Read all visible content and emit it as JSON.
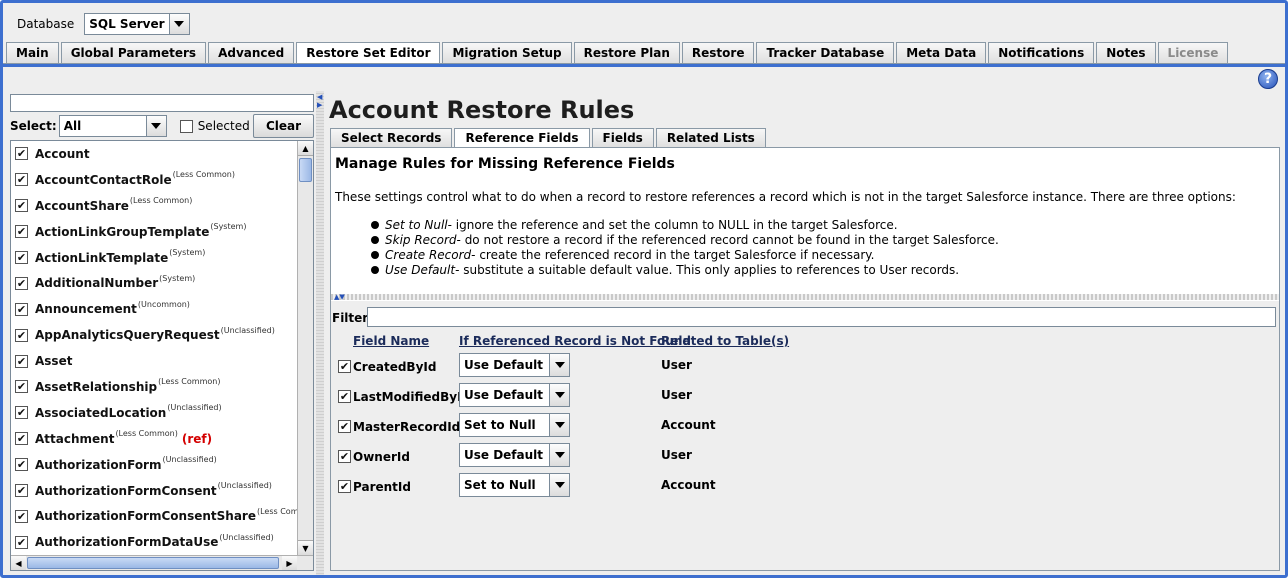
{
  "database": {
    "label": "Database",
    "value": "SQL Server"
  },
  "main_tabs": [
    {
      "label": "Main",
      "active": false,
      "disabled": false
    },
    {
      "label": "Global Parameters",
      "active": false,
      "disabled": false
    },
    {
      "label": "Advanced",
      "active": false,
      "disabled": false
    },
    {
      "label": "Restore Set Editor",
      "active": true,
      "disabled": false
    },
    {
      "label": "Migration Setup",
      "active": false,
      "disabled": false
    },
    {
      "label": "Restore Plan",
      "active": false,
      "disabled": false
    },
    {
      "label": "Restore",
      "active": false,
      "disabled": false
    },
    {
      "label": "Tracker Database",
      "active": false,
      "disabled": false
    },
    {
      "label": "Meta Data",
      "active": false,
      "disabled": false
    },
    {
      "label": "Notifications",
      "active": false,
      "disabled": false
    },
    {
      "label": "Notes",
      "active": false,
      "disabled": false
    },
    {
      "label": "License",
      "active": false,
      "disabled": true
    }
  ],
  "help_icon": "help-icon",
  "left": {
    "search_value": "",
    "select_label": "Select:",
    "select_value": "All",
    "selected_label": "Selected",
    "selected_checked": false,
    "clear_label": "Clear",
    "items": [
      {
        "name": "Account",
        "tag": "",
        "ref": ""
      },
      {
        "name": "AccountContactRole",
        "tag": "(Less Common)",
        "ref": ""
      },
      {
        "name": "AccountShare",
        "tag": "(Less Common)",
        "ref": ""
      },
      {
        "name": "ActionLinkGroupTemplate",
        "tag": "(System)",
        "ref": ""
      },
      {
        "name": "ActionLinkTemplate",
        "tag": "(System)",
        "ref": ""
      },
      {
        "name": "AdditionalNumber",
        "tag": "(System)",
        "ref": ""
      },
      {
        "name": "Announcement",
        "tag": "(Uncommon)",
        "ref": ""
      },
      {
        "name": "AppAnalyticsQueryRequest",
        "tag": "(Unclassified)",
        "ref": ""
      },
      {
        "name": "Asset",
        "tag": "",
        "ref": ""
      },
      {
        "name": "AssetRelationship",
        "tag": "(Less Common)",
        "ref": ""
      },
      {
        "name": "AssociatedLocation",
        "tag": "(Unclassified)",
        "ref": ""
      },
      {
        "name": "Attachment",
        "tag": "(Less Common)",
        "ref": "(ref)"
      },
      {
        "name": "AuthorizationForm",
        "tag": "(Unclassified)",
        "ref": ""
      },
      {
        "name": "AuthorizationFormConsent",
        "tag": "(Unclassified)",
        "ref": ""
      },
      {
        "name": "AuthorizationFormConsentShare",
        "tag": "(Less Common)",
        "ref": ""
      },
      {
        "name": "AuthorizationFormDataUse",
        "tag": "(Unclassified)",
        "ref": ""
      }
    ]
  },
  "right": {
    "title": "Account Restore Rules",
    "sub_tabs": [
      {
        "label": "Select Records",
        "active": false
      },
      {
        "label": "Reference Fields",
        "active": true
      },
      {
        "label": "Fields",
        "active": false
      },
      {
        "label": "Related Lists",
        "active": false
      }
    ],
    "info_title": "Manage Rules for Missing Reference Fields",
    "info_desc": "These settings control what to do when a record to restore references a record which is not in the target Salesforce instance. There are three options:",
    "options": [
      {
        "em": "Set to Null",
        "text": " - ignore the reference and set the column to NULL in the target Salesforce."
      },
      {
        "em": "Skip Record",
        "text": " - do not restore a record if the referenced record cannot be found in the target Salesforce."
      },
      {
        "em": "Create Record",
        "text": "- create the referenced record in the target Salesforce if necessary."
      },
      {
        "em": "Use Default",
        "text": " - substitute a suitable default value. This only applies to references to User records."
      }
    ],
    "filter_label": "Filter:",
    "filter_value": "",
    "columns": {
      "field": "Field Name",
      "action": "If Referenced Record is Not Found",
      "related": "Related to Table(s)"
    },
    "rows": [
      {
        "field": "CreatedById",
        "action": "Use Default",
        "related": "User",
        "checked": true
      },
      {
        "field": "LastModifiedById",
        "action": "Use Default",
        "related": "User",
        "checked": true
      },
      {
        "field": "MasterRecordId",
        "action": "Set to Null",
        "related": "Account",
        "checked": true
      },
      {
        "field": "OwnerId",
        "action": "Use Default",
        "related": "User",
        "checked": true
      },
      {
        "field": "ParentId",
        "action": "Set to Null",
        "related": "Account",
        "checked": true
      }
    ]
  },
  "colors": {
    "accent": "#3d6fcf",
    "ref": "#d40000",
    "panel_bg": "#eeeeee"
  }
}
